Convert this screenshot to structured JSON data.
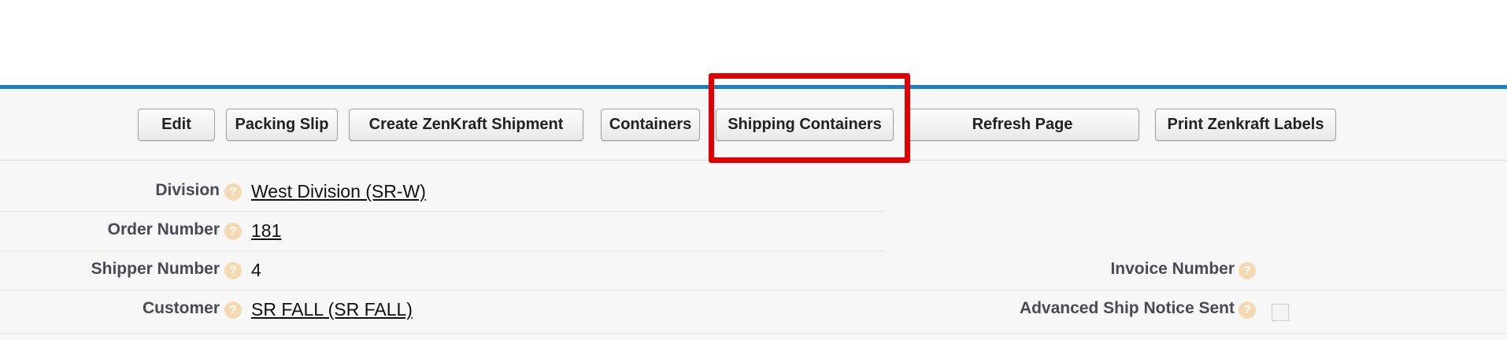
{
  "toolbar": {
    "edit_label": "Edit",
    "packing_slip_label": "Packing Slip",
    "create_zenkraft_label": "Create ZenKraft Shipment",
    "containers_label": "Containers",
    "shipping_containers_label": "Shipping Containers",
    "refresh_label": "Refresh Page",
    "print_zenkraft_label": "Print Zenkraft Labels"
  },
  "fields": {
    "division": {
      "label": "Division",
      "value": "West Division (SR-W)"
    },
    "order_number": {
      "label": "Order Number",
      "value": "181"
    },
    "shipper_number": {
      "label": "Shipper Number",
      "value": "4"
    },
    "customer": {
      "label": "Customer",
      "value": "SR FALL (SR FALL)"
    },
    "invoice_number": {
      "label": "Invoice Number",
      "value": ""
    },
    "advanced_ship_notice_sent": {
      "label": "Advanced Ship Notice Sent",
      "checked": false
    }
  },
  "help_icon_glyph": "?",
  "colors": {
    "accent_rule": "#1b7fc4",
    "highlight": "#e00000",
    "help_icon": "#f5d9b3"
  },
  "icons": {
    "help": "help-icon"
  }
}
